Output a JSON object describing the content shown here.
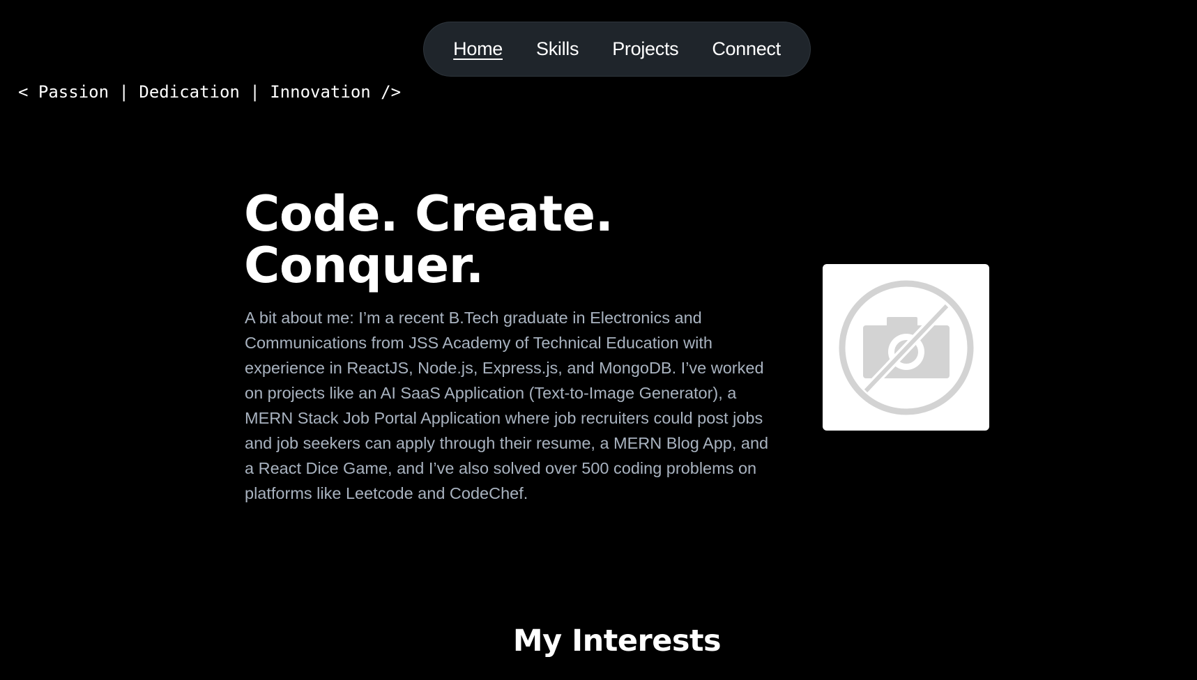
{
  "nav": {
    "items": [
      {
        "label": "Home",
        "active": true
      },
      {
        "label": "Skills",
        "active": false
      },
      {
        "label": "Projects",
        "active": false
      },
      {
        "label": "Connect",
        "active": false
      }
    ]
  },
  "tagline": "< Passion | Dedication | Innovation />",
  "hero": {
    "title_line1": "Code. Create.",
    "title_line2": "Conquer.",
    "about": "A bit about me: I’m a recent B.Tech graduate in Electronics and Communications from JSS Academy of Technical Education with experience in ReactJS, Node.js, Express.js, and MongoDB. I’ve worked on projects like an AI SaaS Application (Text-to-Image Generator), a MERN Stack Job Portal Application where job recruiters could post jobs and job seekers can apply through their resume, a MERN Blog App, and a React Dice Game, and I’ve also solved over 500 coding problems on platforms like Leetcode and CodeChef.",
    "photo_icon": "no-photo-icon"
  },
  "sections": {
    "interests_title": "My Interests"
  },
  "colors": {
    "background": "#000000",
    "nav_background": "#1f252b",
    "body_text": "#a9b3c0",
    "heading_text": "#ffffff"
  }
}
